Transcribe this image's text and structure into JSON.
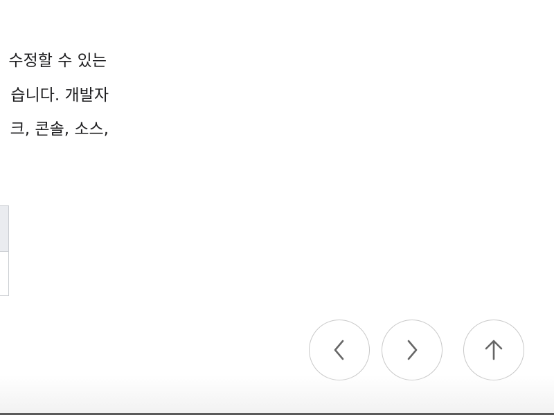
{
  "article": {
    "lines": [
      "수정할 수 있는",
      "습니다. 개발자",
      "크, 콘솔, 소스,"
    ]
  },
  "navigation": {
    "prev_icon": "chevron-left",
    "next_icon": "chevron-right",
    "top_icon": "arrow-up"
  },
  "colors": {
    "text": "#1d1d1f",
    "button_border": "#c8c8c8",
    "icon": "#666666",
    "table_header_bg": "#eaecf0",
    "table_border": "#c9ccd1"
  }
}
